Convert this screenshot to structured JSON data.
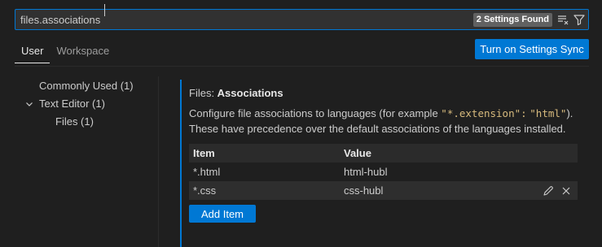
{
  "search": {
    "value": "files.associations",
    "result_badge": "2 Settings Found"
  },
  "tabs": [
    {
      "label": "User",
      "active": true
    },
    {
      "label": "Workspace",
      "active": false
    }
  ],
  "sync_button_label": "Turn on Settings Sync",
  "toc": [
    {
      "label": "Commonly Used (1)",
      "expandable": false
    },
    {
      "label": "Text Editor (1)",
      "expandable": true,
      "expanded": true
    },
    {
      "label": "Files (1)",
      "expandable": false
    }
  ],
  "setting": {
    "category": "Files: ",
    "name": "Associations",
    "desc_part1": "Configure file associations to languages (for example ",
    "desc_code1": "\"*.extension\":",
    "desc_code2": "\"html\"",
    "desc_part2": "). These have precedence over the default associations of the languages installed.",
    "table": {
      "columns": [
        "Item",
        "Value"
      ],
      "rows": [
        {
          "item": "*.html",
          "value": "html-hubl"
        },
        {
          "item": "*.css",
          "value": "css-hubl"
        }
      ]
    },
    "add_button_label": "Add Item"
  },
  "colors": {
    "accent": "#0078d4",
    "background": "#1f1f1f",
    "code": "#d7ba7d"
  },
  "icons": {
    "clear_filter": "clear-filter-icon",
    "filter": "filter-icon",
    "chevron": "chevron-down-icon",
    "edit": "edit-icon",
    "remove": "close-icon"
  }
}
